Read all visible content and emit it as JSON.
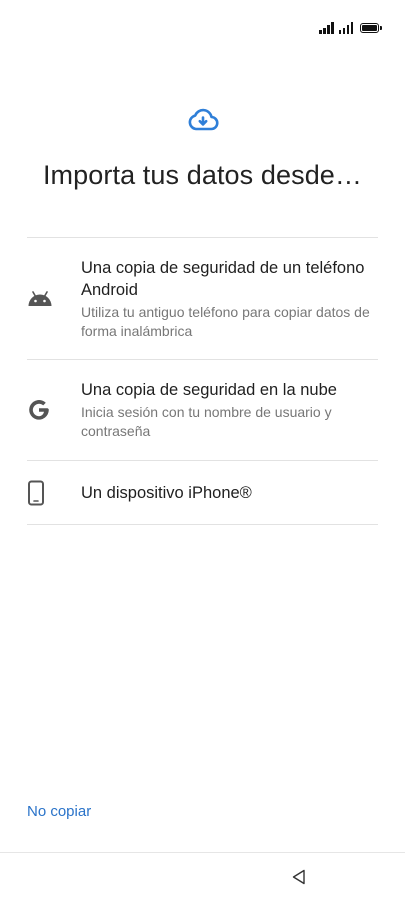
{
  "status_bar": {
    "signal_icons": [
      "signal-1-icon",
      "signal-2-icon"
    ],
    "battery_icon": "battery-icon"
  },
  "header": {
    "icon": "cloud-download-icon",
    "title": "Importa tus datos desde…"
  },
  "options": [
    {
      "icon": "android-icon",
      "title": "Una copia de seguridad de un teléfono Android",
      "subtitle": "Utiliza tu antiguo teléfono para copiar datos de forma inalámbrica"
    },
    {
      "icon": "google-icon",
      "title": "Una copia de seguridad en la nube",
      "subtitle": "Inicia sesión con tu nombre de usuario y contraseña"
    },
    {
      "icon": "phone-icon",
      "title": "Un dispositivo iPhone®",
      "subtitle": ""
    }
  ],
  "footer": {
    "skip_label": "No copiar"
  },
  "navigation": {
    "back_icon": "back-triangle-icon"
  },
  "colors": {
    "accent": "#2a73c9",
    "cloud": "#2f7fd8",
    "text": "#1f1f1f",
    "subtext": "#777777",
    "divider": "#e2e2e2"
  }
}
